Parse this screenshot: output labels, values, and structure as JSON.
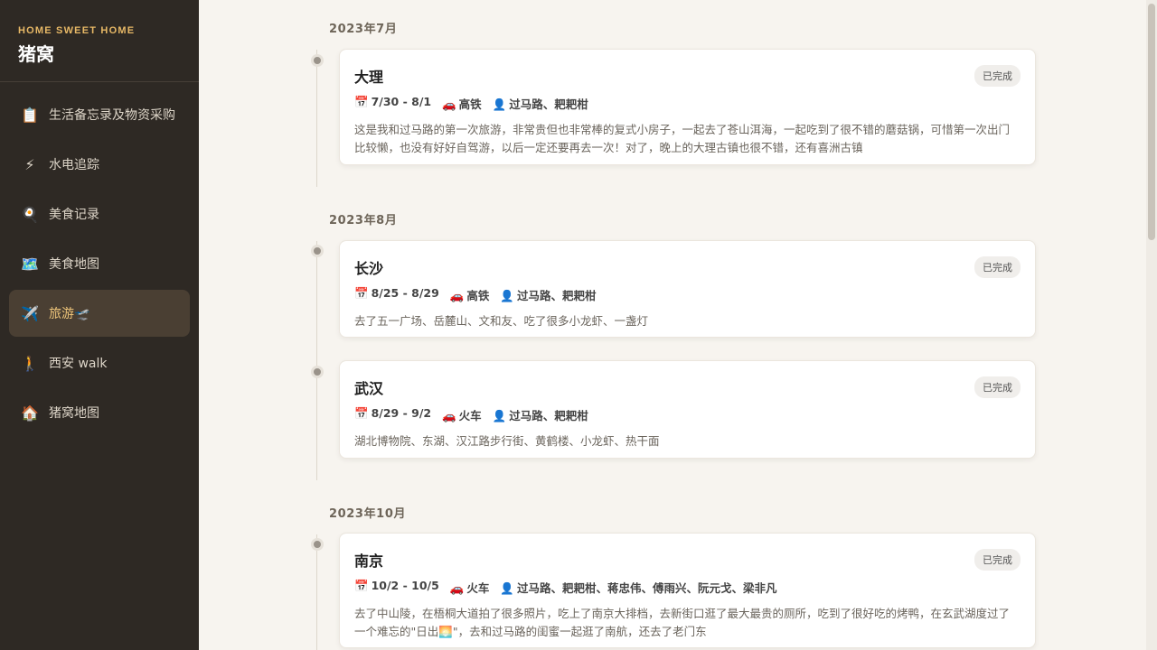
{
  "brand": {
    "subtitle": "HOME SWEET HOME",
    "title": "猪窝"
  },
  "nav": [
    {
      "icon": "📋",
      "label": "生活备忘录及物资采购",
      "active": false
    },
    {
      "icon": "⚡",
      "label": "水电追踪",
      "active": false
    },
    {
      "icon": "🍳",
      "label": "美食记录",
      "active": false
    },
    {
      "icon": "🗺️",
      "label": "美食地图",
      "active": false
    },
    {
      "icon": "✈️",
      "label": "旅游🛫",
      "active": true
    },
    {
      "icon": "🚶",
      "label": "西安 walk",
      "active": false
    },
    {
      "icon": "🏠",
      "label": "猪窝地图",
      "active": false
    }
  ],
  "icons": {
    "date": "📅",
    "transport": "🚗",
    "people": "👤"
  },
  "months": [
    "2023年7月",
    "2023年8月",
    "2023年10月"
  ],
  "trips": [
    {
      "title": "大理",
      "status": "已完成",
      "date": "7/30 - 8/1",
      "transport": "高铁",
      "people": "过马路、耙耙柑",
      "desc": "这是我和过马路的第一次旅游，非常贵但也非常棒的复式小房子，一起去了苍山洱海，一起吃到了很不错的蘑菇锅，可惜第一次出门比较懒，也没有好好自驾游，以后一定还要再去一次！对了，晚上的大理古镇也很不错，还有喜洲古镇"
    },
    {
      "title": "长沙",
      "status": "已完成",
      "date": "8/25 - 8/29",
      "transport": "高铁",
      "people": "过马路、耙耙柑",
      "desc": "去了五一广场、岳麓山、文和友、吃了很多小龙虾、一盏灯"
    },
    {
      "title": "武汉",
      "status": "已完成",
      "date": "8/29 - 9/2",
      "transport": "火车",
      "people": "过马路、耙耙柑",
      "desc": "湖北博物院、东湖、汉江路步行街、黄鹤楼、小龙虾、热干面"
    },
    {
      "title": "南京",
      "status": "已完成",
      "date": "10/2 - 10/5",
      "transport": "火车",
      "people": "过马路、耙耙柑、蒋忠伟、傅雨兴、阮元戈、梁非凡",
      "desc": "去了中山陵，在梧桐大道拍了很多照片，吃上了南京大排档，去新街口逛了最大最贵的厕所，吃到了很好吃的烤鸭，在玄武湖度过了一个难忘的\"日出🌅\"，去和过马路的闺蜜一起逛了南航，还去了老门东"
    }
  ]
}
